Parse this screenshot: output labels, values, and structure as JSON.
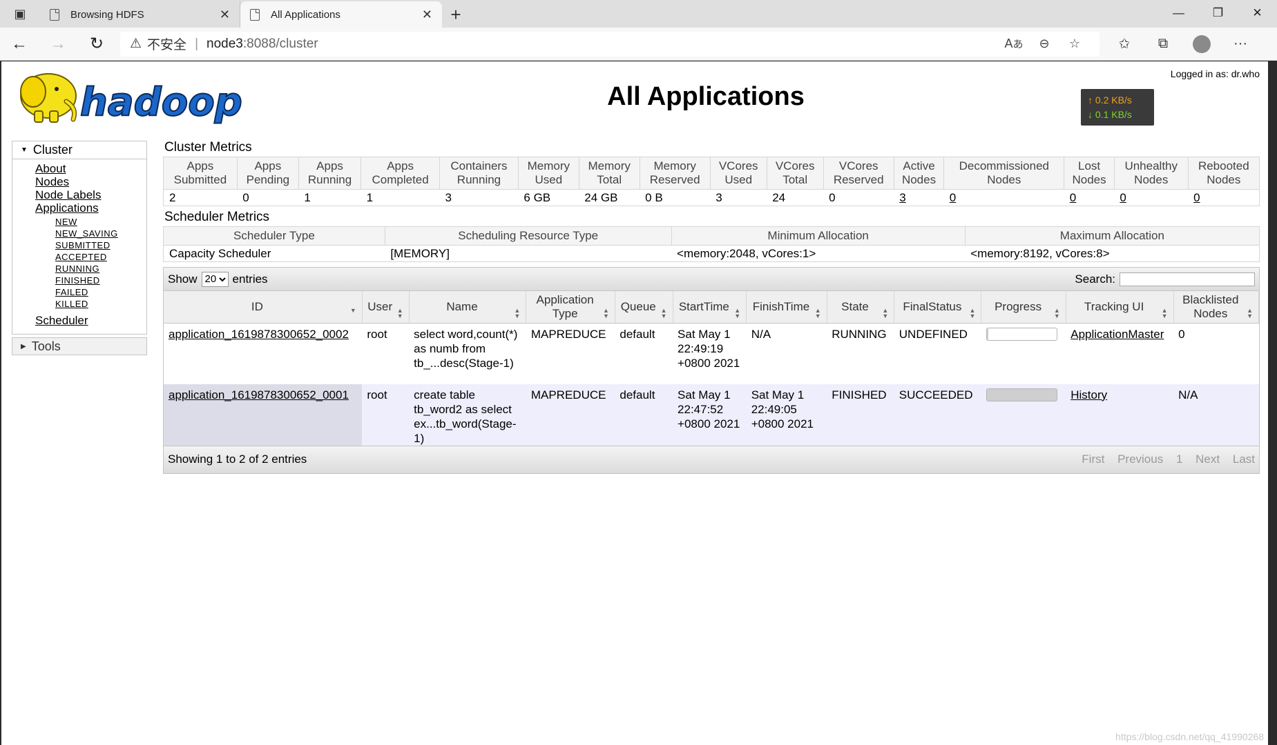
{
  "browser": {
    "tabs": [
      {
        "title": "Browsing HDFS"
      },
      {
        "title": "All Applications"
      }
    ],
    "url": {
      "security": "不安全",
      "host": "node3",
      "path": ":8088/cluster"
    }
  },
  "header": {
    "logo_text": "hadoop",
    "title": "All Applications",
    "logged_in": "Logged in as: dr.who",
    "net_up": "0.2 KB/s",
    "net_down": "0.1 KB/s"
  },
  "sidebar": {
    "cluster_label": "Cluster",
    "links": [
      "About",
      "Nodes",
      "Node Labels",
      "Applications"
    ],
    "app_states": [
      "NEW",
      "NEW_SAVING",
      "SUBMITTED",
      "ACCEPTED",
      "RUNNING",
      "FINISHED",
      "FAILED",
      "KILLED"
    ],
    "scheduler": "Scheduler",
    "tools_label": "Tools"
  },
  "cluster_metrics": {
    "title": "Cluster Metrics",
    "headers": [
      [
        "Apps",
        "Submitted"
      ],
      [
        "Apps",
        "Pending"
      ],
      [
        "Apps",
        "Running"
      ],
      [
        "Apps",
        "Completed"
      ],
      [
        "Containers",
        "Running"
      ],
      [
        "Memory",
        "Used"
      ],
      [
        "Memory",
        "Total"
      ],
      [
        "Memory",
        "Reserved"
      ],
      [
        "VCores",
        "Used"
      ],
      [
        "VCores",
        "Total"
      ],
      [
        "VCores",
        "Reserved"
      ],
      [
        "Active",
        "Nodes"
      ],
      [
        "Decommissioned",
        "Nodes"
      ],
      [
        "Lost",
        "Nodes"
      ],
      [
        "Unhealthy",
        "Nodes"
      ],
      [
        "Rebooted",
        "Nodes"
      ]
    ],
    "values": [
      "2",
      "0",
      "1",
      "1",
      "3",
      "6 GB",
      "24 GB",
      "0 B",
      "3",
      "24",
      "0",
      "3",
      "0",
      "0",
      "0",
      "0"
    ]
  },
  "scheduler_metrics": {
    "title": "Scheduler Metrics",
    "headers": [
      "Scheduler Type",
      "Scheduling Resource Type",
      "Minimum Allocation",
      "Maximum Allocation"
    ],
    "values": [
      "Capacity Scheduler",
      "[MEMORY]",
      "<memory:2048, vCores:1>",
      "<memory:8192, vCores:8>"
    ]
  },
  "apps_table": {
    "show_label": "Show",
    "entries_value": "20",
    "entries_label": "entries",
    "search_label": "Search:",
    "columns": [
      "ID",
      "User",
      "Name",
      "Application Type",
      "Queue",
      "StartTime",
      "FinishTime",
      "State",
      "FinalStatus",
      "Progress",
      "Tracking UI",
      "Blacklisted Nodes"
    ],
    "rows": [
      {
        "id": "application_1619878300652_0002",
        "user": "root",
        "name": "select word,count(*) as numb from tb_...desc(Stage-1)",
        "type": "MAPREDUCE",
        "queue": "default",
        "start": "Sat May 1 22:49:19 +0800 2021",
        "finish": "N/A",
        "state": "RUNNING",
        "final_status": "UNDEFINED",
        "progress": 0.02,
        "tracking": "ApplicationMaster",
        "blacklisted": "0"
      },
      {
        "id": "application_1619878300652_0001",
        "user": "root",
        "name": "create table tb_word2 as select ex...tb_word(Stage-1)",
        "type": "MAPREDUCE",
        "queue": "default",
        "start": "Sat May 1 22:47:52 +0800 2021",
        "finish": "Sat May 1 22:49:05 +0800 2021",
        "state": "FINISHED",
        "final_status": "SUCCEEDED",
        "progress": 1.0,
        "tracking": "History",
        "blacklisted": "N/A"
      }
    ],
    "info": "Showing 1 to 2 of 2 entries",
    "pager": [
      "First",
      "Previous",
      "1",
      "Next",
      "Last"
    ]
  },
  "watermark": "https://blog.csdn.net/qq_41990268",
  "colors": {
    "accent_logo": "#f5e11a",
    "logo_blue": "#1b66c9",
    "net_up": "#f0a020",
    "net_down": "#7fd430"
  }
}
